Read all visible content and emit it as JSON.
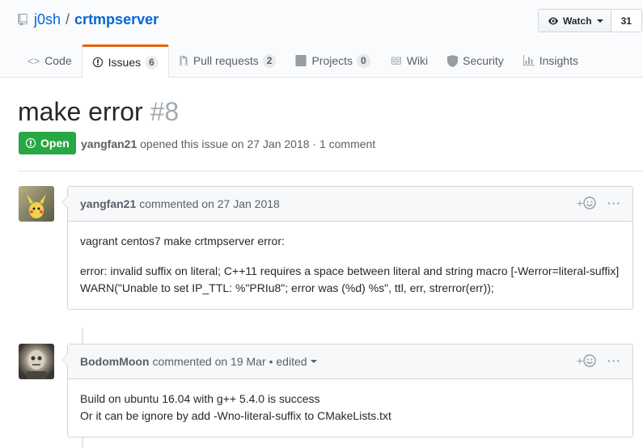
{
  "repo": {
    "owner": "j0sh",
    "separator": "/",
    "name": "crtmpserver"
  },
  "watch": {
    "label": "Watch",
    "count": "31"
  },
  "tabs": [
    {
      "label": "Code",
      "icon": "code-icon"
    },
    {
      "label": "Issues",
      "count": "6",
      "icon": "issue-opened-icon",
      "selected": true
    },
    {
      "label": "Pull requests",
      "count": "2",
      "icon": "pull-request-icon"
    },
    {
      "label": "Projects",
      "count": "0",
      "icon": "project-icon"
    },
    {
      "label": "Wiki",
      "icon": "book-icon"
    },
    {
      "label": "Security",
      "icon": "shield-icon"
    },
    {
      "label": "Insights",
      "icon": "graph-icon"
    }
  ],
  "issue": {
    "title": "make error",
    "number": "#8",
    "state": "Open",
    "author": "yangfan21",
    "meta_text": "opened this issue on 27 Jan 2018 · 1 comment"
  },
  "comments": [
    {
      "author": "yangfan21",
      "header_text": "commented on 27 Jan 2018",
      "body": [
        "vagrant centos7 make crtmpserver error:",
        "error: invalid suffix on literal; C++11 requires a space between literal and string macro [-Werror=literal-suffix]",
        "WARN(\"Unable to set IP_TTL: %\"PRIu8\"; error was (%d) %s\", ttl, err, strerror(err));"
      ]
    },
    {
      "author": "BodomMoon",
      "header_text": "commented on 19 Mar",
      "edited": "• edited",
      "body": [
        "Build on ubuntu 16.04 with g++ 5.4.0 is success",
        "Or it can be ignore by add -Wno-literal-suffix to CMakeLists.txt"
      ]
    }
  ],
  "actions": {
    "reaction_plus": "+",
    "more": "···"
  },
  "colors": {
    "accent_tab": "#e36209",
    "open_state": "#28a745",
    "link": "#0366d6"
  }
}
